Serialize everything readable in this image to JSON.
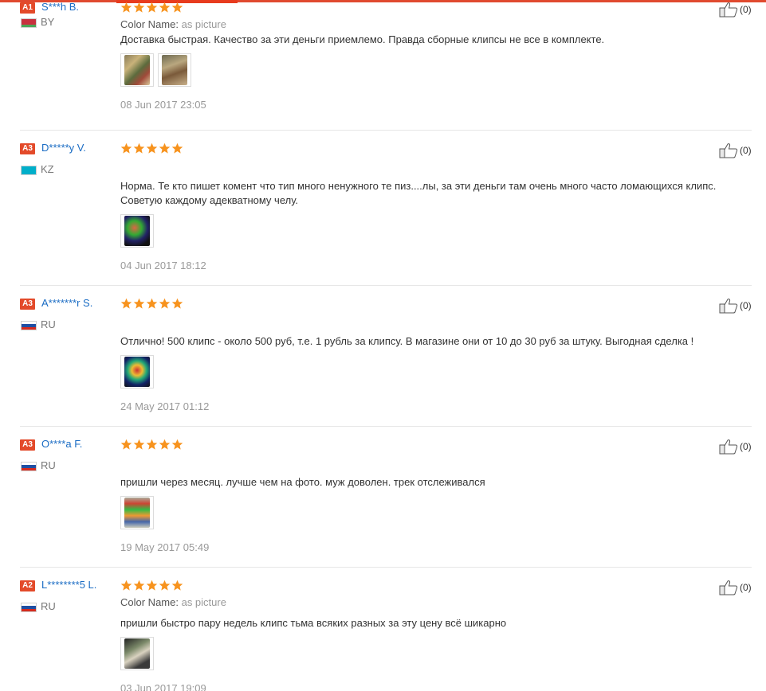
{
  "color_label": "Color Name:",
  "colors": {
    "author": "#1a6cc4",
    "badge": "#e34a2a",
    "star": "#f7931e",
    "date": "#999999",
    "accent": "#e83b1e"
  },
  "reviews": [
    {
      "level": "A1",
      "author": "S***h B.",
      "country": "BY",
      "flag": [
        "#c8313e",
        "#c8313e",
        "#4aa657"
      ],
      "color_value": "as picture",
      "text": "Доставка быстрая. Качество за эти деньги приемлемо. Правда сборные клипсы не все в комплекте.",
      "date": "08 Jun 2017 23:05",
      "likes": "(0)",
      "photos": 2
    },
    {
      "level": "A3",
      "author": "D*****y V.",
      "country": "KZ",
      "flag": [
        "#00afca",
        "#00afca",
        "#00afca"
      ],
      "color_value": "",
      "text": "Норма. Те кто пишет комент что тип много ненужного те пиз....лы, за эти деньги там очень много часто ломающихся клипс. Советую каждому адекватному челу.",
      "date": "04 Jun 2017 18:12",
      "likes": "(0)",
      "photos": 1
    },
    {
      "level": "A3",
      "author": "A*******r S.",
      "country": "RU",
      "flag": [
        "#ffffff",
        "#1f4fa3",
        "#d52b1e"
      ],
      "color_value": "",
      "text": "Отлично! 500 клипс - около 500 руб, т.е. 1 рубль за клипсу. В магазине они от 10 до 30 руб за штуку. Выгодная сделка !",
      "date": "24 May 2017 01:12",
      "likes": "(0)",
      "photos": 1
    },
    {
      "level": "A3",
      "author": "O****a F.",
      "country": "RU",
      "flag": [
        "#ffffff",
        "#1f4fa3",
        "#d52b1e"
      ],
      "color_value": "",
      "text": "пришли через месяц. лучше чем на фото. муж доволен. трек отслеживался",
      "date": "19 May 2017 05:49",
      "likes": "(0)",
      "photos": 1
    },
    {
      "level": "A2",
      "author": "L********5 L.",
      "country": "RU",
      "flag": [
        "#ffffff",
        "#1f4fa3",
        "#d52b1e"
      ],
      "color_value": "as picture",
      "text": "пришли быстро пару недель клипс тьма всяких разных за эту цену всё шикарно",
      "date": "03 Jun 2017 19:09",
      "likes": "(0)",
      "photos": 1
    }
  ]
}
